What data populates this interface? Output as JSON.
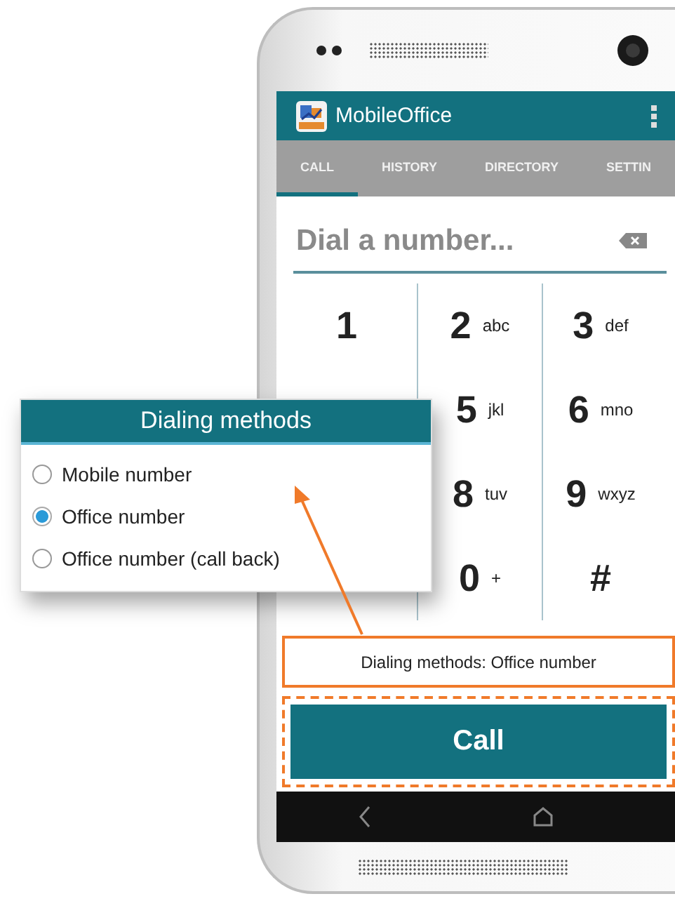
{
  "app": {
    "title": "MobileOffice"
  },
  "tabs": [
    {
      "label": "CALL",
      "selected": true
    },
    {
      "label": "HISTORY",
      "selected": false
    },
    {
      "label": "DIRECTORY",
      "selected": false
    },
    {
      "label": "SETTIN",
      "selected": false
    }
  ],
  "dial_field": {
    "placeholder": "Dial a number..."
  },
  "keypad_rows": [
    [
      {
        "digit": "1"
      },
      {
        "digit": "2",
        "letters": "abc"
      },
      {
        "digit": "3",
        "letters": "def"
      }
    ],
    [
      {
        "digit": "5",
        "letters": "jkl"
      },
      {
        "digit": "6",
        "letters": "mno"
      }
    ],
    [
      {
        "digit": "8",
        "letters": "tuv"
      },
      {
        "digit": "9",
        "letters": "wxyz"
      }
    ],
    [
      {
        "digit": "0",
        "letters": "+"
      },
      {
        "digit": "#"
      }
    ]
  ],
  "status_line": "Dialing methods: Office number",
  "call_button": "Call",
  "dialog": {
    "title": "Dialing methods",
    "options": [
      {
        "label": "Mobile number",
        "selected": false
      },
      {
        "label": "Office number",
        "selected": true
      },
      {
        "label": "Office number (call back)",
        "selected": false
      }
    ]
  }
}
